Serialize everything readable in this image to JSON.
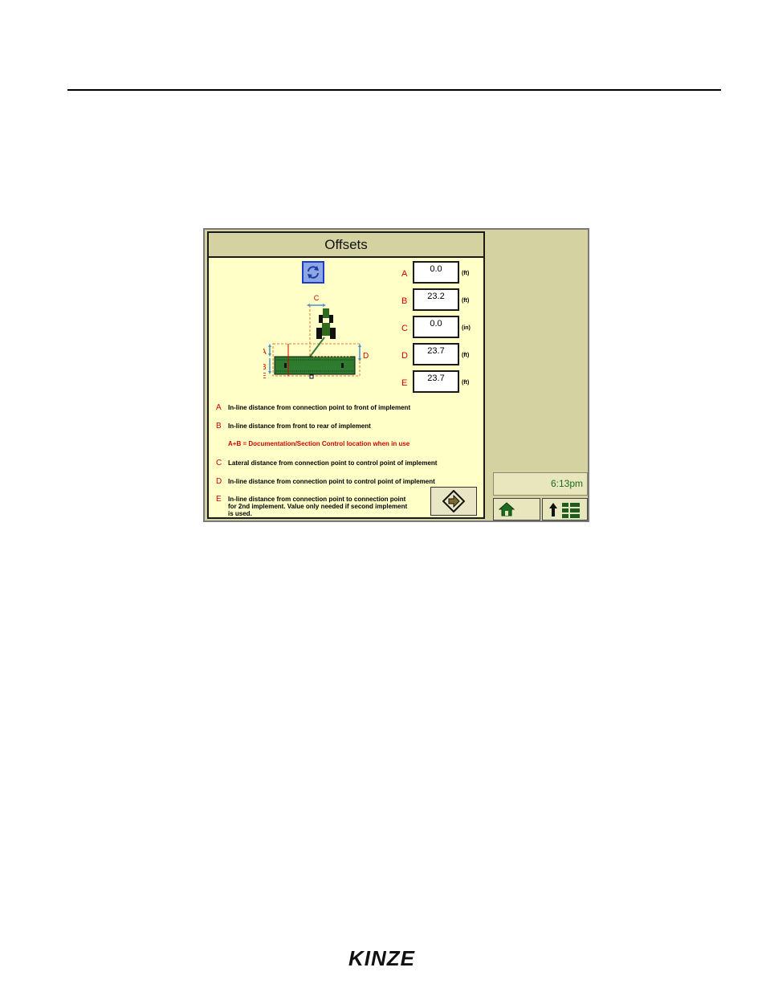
{
  "screen": {
    "title": "Offsets",
    "fields": [
      {
        "letter": "A",
        "value": "0.0",
        "unit": "(ft)"
      },
      {
        "letter": "B",
        "value": "23.2",
        "unit": "(ft)"
      },
      {
        "letter": "C",
        "value": "0.0",
        "unit": "(in)"
      },
      {
        "letter": "D",
        "value": "23.7",
        "unit": "(ft)"
      },
      {
        "letter": "E",
        "value": "23.7",
        "unit": "(ft)"
      }
    ],
    "diagram_labels": {
      "a": "A",
      "b": "B",
      "c": "C",
      "d": "D",
      "e": "E"
    },
    "descriptions": [
      {
        "letter": "A",
        "text": "In-line distance from connection point to front of implement"
      },
      {
        "letter": "B",
        "text": "In-line distance from front to rear of implement"
      },
      {
        "letter": "C",
        "text": "Lateral distance from connection point to control point of implement"
      },
      {
        "letter": "D",
        "text": "In-line distance from connection point to control point of implement"
      },
      {
        "letter": "E",
        "text_lines": [
          "In-line distance from connection point to connection point",
          "for 2nd implement.  Value only needed if second implement",
          "is used."
        ]
      }
    ],
    "note": "A+B = Documentation/Section Control location when in use",
    "clock": "6:13pm"
  },
  "brand": {
    "logo_text": "KINZE"
  },
  "icons": [
    "refresh-icon",
    "next-arrow-icon",
    "home-icon",
    "menu-up-icon"
  ],
  "colors": {
    "panel": "#ffffc8",
    "frame": "#d4d2a0",
    "letter_red": "#d40000",
    "clock_green": "#1c6a1c",
    "implement_green": "#2e7a2e"
  }
}
